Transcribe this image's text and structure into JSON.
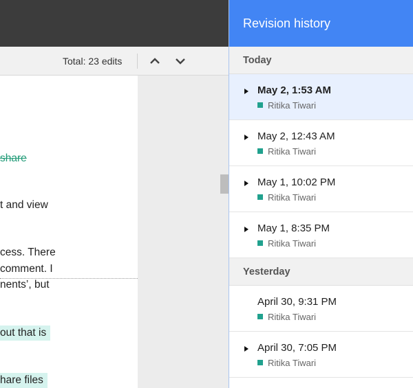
{
  "toolbar": {
    "total_edits": "Total: 23 edits",
    "up_icon": "chevron-up-icon",
    "down_icon": "chevron-down-icon"
  },
  "document": {
    "lines": [
      "share",
      "t and view",
      "cess. There",
      " comment. I",
      "nents’, but",
      "out that is",
      "hare files"
    ]
  },
  "panel": {
    "title": "Revision history",
    "groups": [
      {
        "label": "Today"
      },
      {
        "label": "Yesterday"
      }
    ],
    "revisions": [
      {
        "date": "May 2, 1:53 AM",
        "author": "Ritika Tiwari"
      },
      {
        "date": "May 2, 12:43 AM",
        "author": "Ritika Tiwari"
      },
      {
        "date": "May 1, 10:02 PM",
        "author": "Ritika Tiwari"
      },
      {
        "date": "May 1, 8:35 PM",
        "author": "Ritika Tiwari"
      },
      {
        "date": "April 30, 9:31 PM",
        "author": "Ritika Tiwari"
      },
      {
        "date": "April 30, 7:05 PM",
        "author": "Ritika Tiwari"
      }
    ],
    "author_color": "#21a18e",
    "accent": "#4285f4"
  }
}
